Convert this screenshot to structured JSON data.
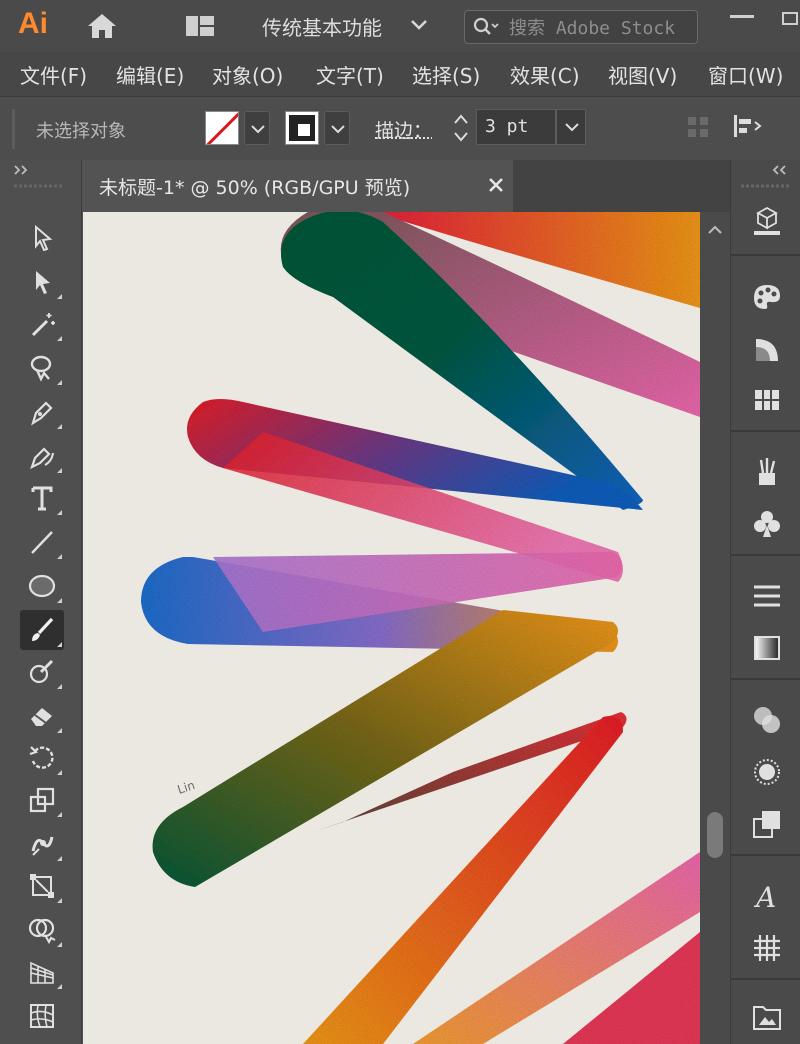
{
  "app": {
    "logo_text": "Ai",
    "workspace": "传统基本功能",
    "search_placeholder": "搜索 Adobe Stock"
  },
  "menu": [
    {
      "label": "文件(F)"
    },
    {
      "label": "编辑(E)"
    },
    {
      "label": "对象(O)"
    },
    {
      "label": "文字(T)"
    },
    {
      "label": "选择(S)"
    },
    {
      "label": "效果(C)"
    },
    {
      "label": "视图(V)"
    },
    {
      "label": "窗口(W)"
    }
  ],
  "control_bar": {
    "selection_status": "未选择对象",
    "stroke_label": "描边：",
    "stroke_weight": "3 pt"
  },
  "document": {
    "tab_title": "未标题-1* @ 50% (RGB/GPU 预览)",
    "signature": "Lin"
  },
  "colors": {
    "accent_logo": "#ff8a2b",
    "artboard_bg": "#ebe8e2",
    "dark_green": "#0b5a3a",
    "red": "#e8202a",
    "blue": "#1f6fd0",
    "orange": "#f39a1a",
    "pink": "#f06ab0",
    "purple": "#a878d8"
  },
  "tools": [
    {
      "icon": "direct-selection-icon",
      "active": false
    },
    {
      "icon": "selection-icon",
      "active": false
    },
    {
      "icon": "magic-wand-icon",
      "active": false
    },
    {
      "icon": "lasso-icon",
      "active": false
    },
    {
      "icon": "pen-icon",
      "active": false
    },
    {
      "icon": "curvature-icon",
      "active": false
    },
    {
      "icon": "type-icon",
      "active": false
    },
    {
      "icon": "line-segment-icon",
      "active": false
    },
    {
      "icon": "ellipse-icon",
      "active": false
    },
    {
      "icon": "paintbrush-icon",
      "active": true
    },
    {
      "icon": "shaper-icon",
      "active": false
    },
    {
      "icon": "eraser-icon",
      "active": false
    },
    {
      "icon": "rotate-icon",
      "active": false
    },
    {
      "icon": "scale-icon",
      "active": false
    },
    {
      "icon": "puppet-warp-icon",
      "active": false
    },
    {
      "icon": "free-transform-icon",
      "active": false
    },
    {
      "icon": "shape-builder-icon",
      "active": false
    },
    {
      "icon": "perspective-grid-icon",
      "active": false
    },
    {
      "icon": "mesh-icon",
      "active": false
    }
  ],
  "panels": [
    {
      "icon": "properties-icon"
    },
    {
      "icon": "color-palette-icon"
    },
    {
      "icon": "color-guide-icon"
    },
    {
      "icon": "swatches-icon"
    },
    {
      "icon": "brushes-icon"
    },
    {
      "icon": "symbols-icon"
    },
    {
      "icon": "stroke-icon"
    },
    {
      "icon": "gradient-icon"
    },
    {
      "icon": "transparency-icon"
    },
    {
      "icon": "appearance-icon"
    },
    {
      "icon": "graphic-styles-icon"
    },
    {
      "icon": "character-icon"
    },
    {
      "icon": "glyphs-icon"
    },
    {
      "icon": "libraries-icon"
    }
  ]
}
